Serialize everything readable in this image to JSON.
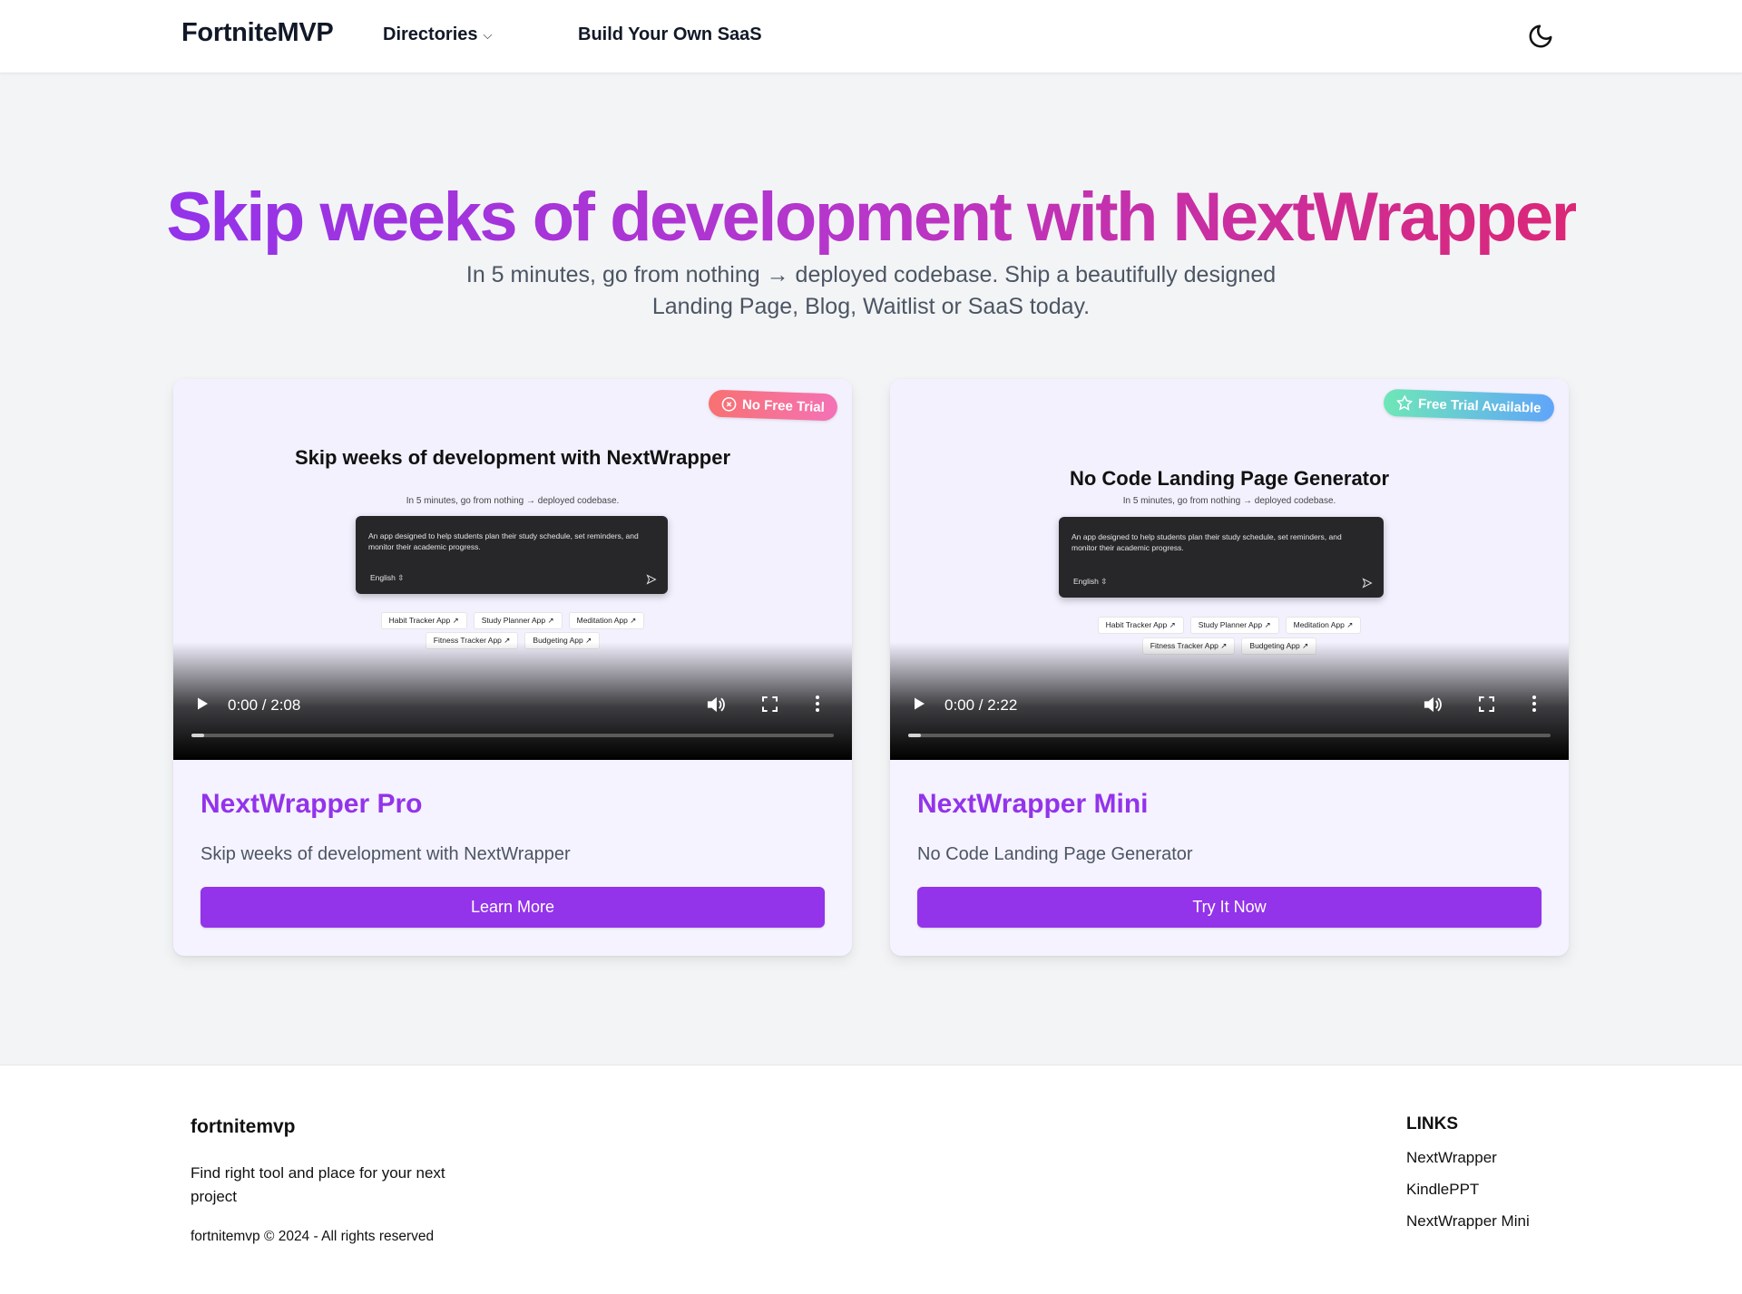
{
  "header": {
    "logo": "FortniteMVP",
    "nav_directories": "Directories",
    "nav_build": "Build Your Own SaaS",
    "theme_icon": "moon-icon"
  },
  "hero": {
    "title": "Skip weeks of development with NextWrapper",
    "subtitle": "In 5 minutes, go from nothing → deployed codebase. Ship a beautifully designed Landing Page, Blog, Waitlist or SaaS today."
  },
  "cards": [
    {
      "badge": "No Free Trial",
      "badge_icon": "x-circle-icon",
      "preview": {
        "title": "Skip weeks of development with NextWrapper",
        "subtitle": "In 5 minutes, go from nothing → deployed codebase.",
        "prompt": "An app designed to help students plan their study schedule, set reminders, and monitor their academic progress.",
        "language": "English",
        "chips_row1": [
          "Habit Tracker App ↗",
          "Study Planner App ↗",
          "Meditation App ↗"
        ],
        "chips_row2": [
          "Fitness Tracker App ↗",
          "Budgeting App ↗"
        ]
      },
      "video_time": "0:00 / 2:08",
      "video_progress": 0.02,
      "title": "NextWrapper Pro",
      "description": "Skip weeks of development with NextWrapper",
      "button": "Learn More"
    },
    {
      "badge": "Free Trial Available",
      "badge_icon": "star-icon",
      "preview": {
        "title": "No Code Landing Page Generator",
        "subtitle": "In 5 minutes, go from nothing → deployed codebase.",
        "prompt": "An app designed to help students plan their study schedule, set reminders, and monitor their academic progress.",
        "language": "English",
        "chips_row1": [
          "Habit Tracker App ↗",
          "Study Planner App ↗",
          "Meditation App ↗"
        ],
        "chips_row2": [
          "Fitness Tracker App ↗",
          "Budgeting App ↗"
        ]
      },
      "video_time": "0:00 / 2:22",
      "video_progress": 0.02,
      "title": "NextWrapper Mini",
      "description": "No Code Landing Page Generator",
      "button": "Try It Now"
    }
  ],
  "footer": {
    "brand": "fortnitemvp",
    "tagline": "Find right tool and place for your next project",
    "copyright": "fortnitemvp © 2024 - All rights reserved",
    "links_heading": "LINKS",
    "links": [
      "NextWrapper",
      "KindlePPT",
      "NextWrapper Mini"
    ]
  },
  "colors": {
    "accent": "#9333ea",
    "gradient_end": "#db2777",
    "background": "#f3f4f6"
  }
}
